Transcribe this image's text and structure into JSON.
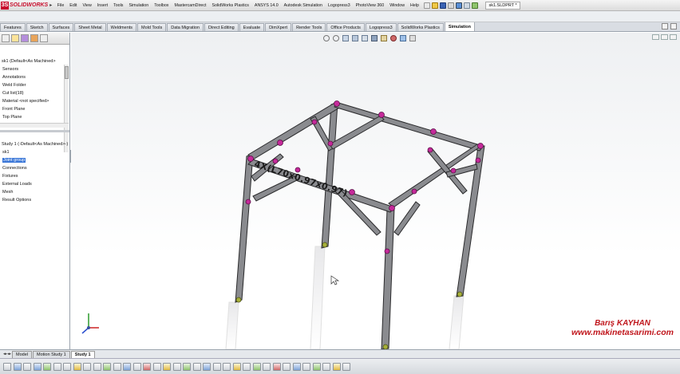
{
  "app": {
    "logo_text": "SOLIDWORKS",
    "document_title": "sk1.SLDPRT *"
  },
  "menu": [
    "File",
    "Edit",
    "View",
    "Insert",
    "Tools",
    "Simulation",
    "Toolbox",
    "MastercamDirect",
    "SolidWorks Plastics",
    "ANSYS 14.0",
    "Autodesk Simulation",
    "Logopress3",
    "PhotoView 360",
    "Window",
    "Help"
  ],
  "command_tabs": [
    "Features",
    "Sketch",
    "Surfaces",
    "Sheet Metal",
    "Weldments",
    "Mold Tools",
    "Data Migration",
    "Direct Editing",
    "Evaluate",
    "DimXpert",
    "Render Tools",
    "Office Products",
    "Logopress3",
    "SolidWorks Plastics",
    "Simulation"
  ],
  "active_tab": "Simulation",
  "feature_tree": {
    "part_label": "sk1 (Default<As Machined>",
    "items": [
      "Sensors",
      "Annotations",
      "Weld Folder",
      "Cut list(18)",
      "Material <not specified>",
      "Front Plane",
      "Top Plane"
    ]
  },
  "simulation_tree": {
    "study_label": "Study 1 (-Default<As Machined>-)",
    "items": [
      "sk1",
      "Joint group",
      "Connections",
      "Fixtures",
      "External Loads",
      "Mesh",
      "Result Options"
    ],
    "selected": "Joint group"
  },
  "annotation_text": "4X(L70x0.97x0.97)",
  "bottom_tabs": [
    "Model",
    "Motion Study 1",
    "Study 1"
  ],
  "active_bottom_tab": "Study 1",
  "watermark": {
    "name": "Barış KAYHAN",
    "url": "www.makinetasarimi.com"
  },
  "colors": {
    "frame_member": "#77787c",
    "joint": "#c52a9a",
    "fixture": "#a7b03a",
    "watermark": "#c0161c"
  }
}
